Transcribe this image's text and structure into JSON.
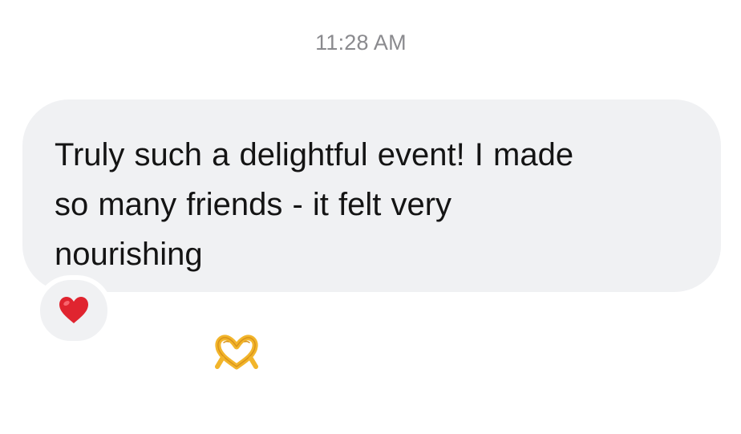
{
  "conversation": {
    "timestamp": "11:28 AM",
    "message": {
      "text_lines": [
        "Truly such a delightful event! I made",
        "so many friends - it felt very",
        "nourishing"
      ],
      "emoji": "heart-hands-emoji",
      "bubble_color": "#f0f1f3"
    },
    "reaction": {
      "icon": "red-heart-emoji",
      "color": "#e0242f"
    }
  }
}
